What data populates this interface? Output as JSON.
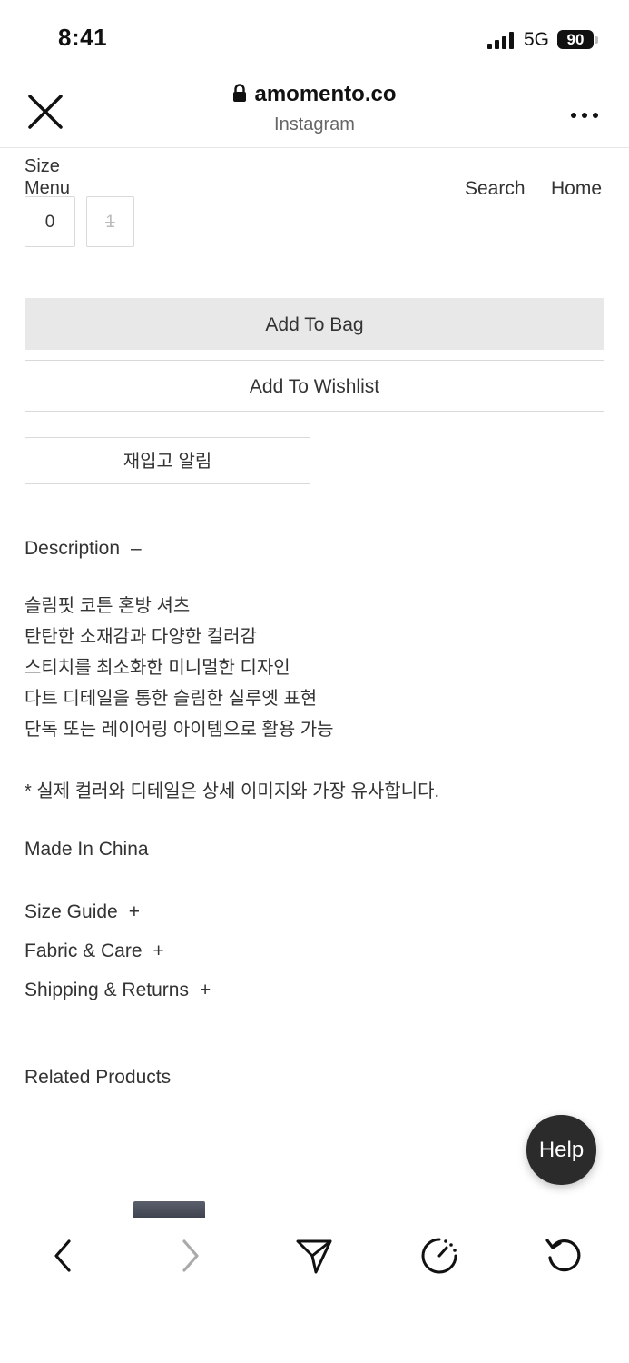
{
  "status_bar": {
    "time": "8:41",
    "network": "5G",
    "battery": "90"
  },
  "browser": {
    "domain": "amomento.co",
    "subtitle": "Instagram",
    "close_icon": "close-icon",
    "more_icon": "more-icon"
  },
  "page": {
    "size_label": "Size",
    "menu_label": "Menu",
    "nav": {
      "search": "Search",
      "home": "Home"
    },
    "size_options": [
      "0",
      "1"
    ],
    "add_to_bag": "Add To Bag",
    "add_to_wishlist": "Add To Wishlist",
    "restock_alert": "재입고 알림",
    "description": {
      "title": "Description",
      "toggle": "–",
      "lines": [
        "슬림핏 코튼 혼방 셔츠",
        "탄탄한 소재감과 다양한 컬러감",
        "스티치를 최소화한 미니멀한 디자인",
        "다트 디테일을 통한 슬림한 실루엣 표현",
        "단독 또는 레이어링 아이템으로 활용 가능"
      ],
      "note": "* 실제 컬러와 디테일은 상세 이미지와 가장 유사합니다.",
      "origin": "Made In China"
    },
    "accordions": [
      {
        "label": "Size Guide",
        "toggle": "+"
      },
      {
        "label": "Fabric & Care",
        "toggle": "+"
      },
      {
        "label": "Shipping & Returns",
        "toggle": "+"
      }
    ],
    "related_title": "Related Products",
    "help": "Help"
  },
  "toolbar": {
    "icons": [
      "back-icon",
      "forward-icon",
      "share-icon",
      "timer-icon",
      "refresh-icon"
    ]
  }
}
